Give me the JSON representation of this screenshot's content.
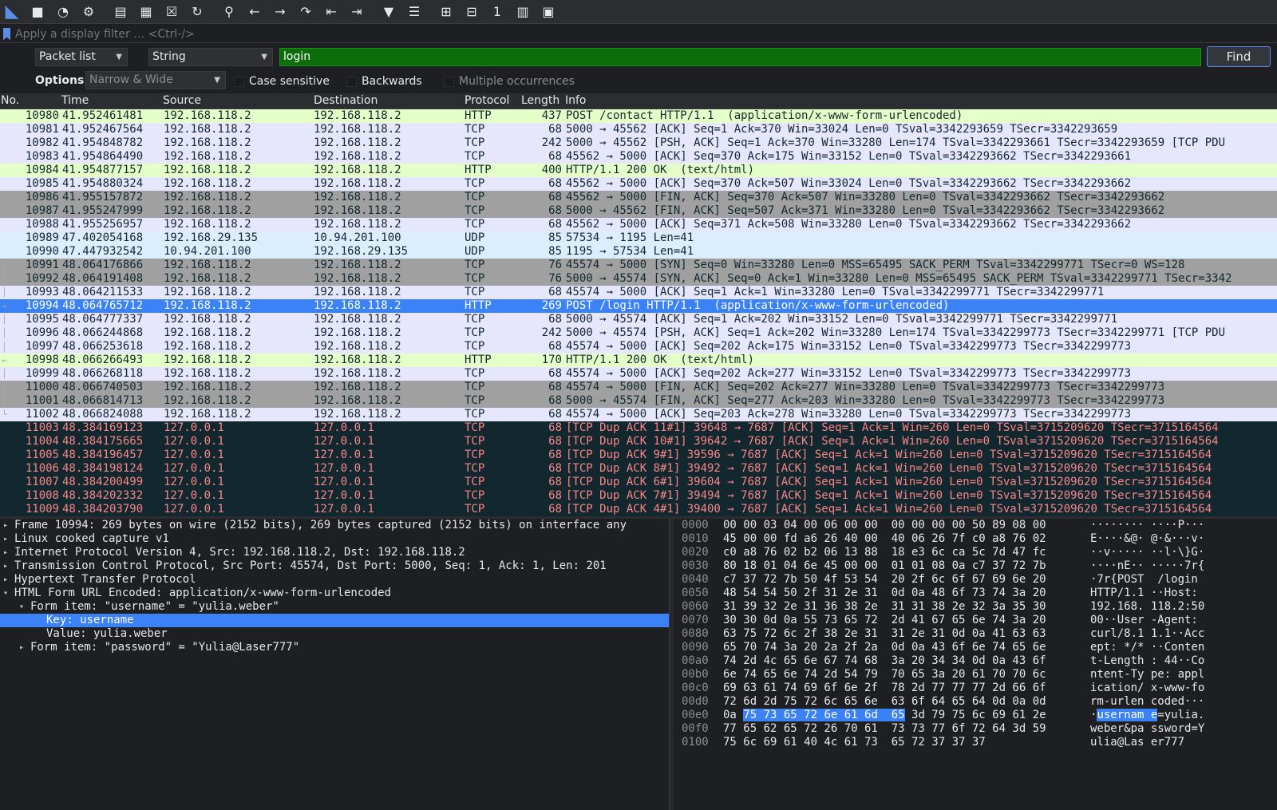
{
  "toolbar": {
    "buttons": [
      {
        "name": "shark-fin-start-icon",
        "glyph": "◣"
      },
      {
        "name": "stop-capture-icon",
        "glyph": "■"
      },
      {
        "name": "restart-capture-icon",
        "glyph": "◔"
      },
      {
        "name": "capture-options-icon",
        "glyph": "⚙"
      },
      {
        "name": "open-file-icon",
        "glyph": "▤"
      },
      {
        "name": "save-file-icon",
        "glyph": "▦"
      },
      {
        "name": "close-file-icon",
        "glyph": "☒"
      },
      {
        "name": "reload-file-icon",
        "glyph": "↻"
      },
      {
        "name": "find-packet-icon",
        "glyph": "⚲"
      },
      {
        "name": "go-back-icon",
        "glyph": "←"
      },
      {
        "name": "go-forward-icon",
        "glyph": "→"
      },
      {
        "name": "go-to-packet-icon",
        "glyph": "↷"
      },
      {
        "name": "first-packet-icon",
        "glyph": "⇤"
      },
      {
        "name": "last-packet-icon",
        "glyph": "⇥"
      },
      {
        "name": "auto-scroll-icon",
        "glyph": "▼"
      },
      {
        "name": "colorize-icon",
        "glyph": "☰"
      },
      {
        "name": "zoom-in-icon",
        "glyph": "⊞"
      },
      {
        "name": "zoom-out-icon",
        "glyph": "⊟"
      },
      {
        "name": "normal-size-icon",
        "glyph": "1"
      },
      {
        "name": "resize-columns-icon",
        "glyph": "▥"
      },
      {
        "name": "layout-icon",
        "glyph": "▣"
      }
    ]
  },
  "filter": {
    "placeholder": "Apply a display filter … <Ctrl-/>"
  },
  "find": {
    "search_in": "Packet list",
    "search_type": "String",
    "query": "login",
    "find_label": "Find"
  },
  "options": {
    "label": "Options:",
    "charset": "Narrow & Wide",
    "case_sensitive": "Case sensitive",
    "backwards": "Backwards",
    "multiple": "Multiple occurrences"
  },
  "packet_list": {
    "columns": [
      "No.",
      "Time",
      "Source",
      "Destination",
      "Protocol",
      "Length",
      "Info"
    ],
    "rows": [
      {
        "no": "10980",
        "time": "41.952461481",
        "src": "192.168.118.2",
        "dst": "192.168.118.2",
        "proto": "HTTP",
        "len": "437",
        "info": "POST /contact HTTP/1.1  (application/x-www-form-urlencoded)",
        "style": "http",
        "rel": ""
      },
      {
        "no": "10981",
        "time": "41.952467564",
        "src": "192.168.118.2",
        "dst": "192.168.118.2",
        "proto": "TCP",
        "len": "68",
        "info": "5000 → 45562 [ACK] Seq=1 Ack=370 Win=33024 Len=0 TSval=3342293659 TSecr=3342293659",
        "style": "tcp",
        "rel": ""
      },
      {
        "no": "10982",
        "time": "41.954848782",
        "src": "192.168.118.2",
        "dst": "192.168.118.2",
        "proto": "TCP",
        "len": "242",
        "info": "5000 → 45562 [PSH, ACK] Seq=1 Ack=370 Win=33280 Len=174 TSval=3342293661 TSecr=3342293659 [TCP PDU",
        "style": "tcp",
        "rel": ""
      },
      {
        "no": "10983",
        "time": "41.954864490",
        "src": "192.168.118.2",
        "dst": "192.168.118.2",
        "proto": "TCP",
        "len": "68",
        "info": "45562 → 5000 [ACK] Seq=370 Ack=175 Win=33152 Len=0 TSval=3342293662 TSecr=3342293661",
        "style": "tcp",
        "rel": ""
      },
      {
        "no": "10984",
        "time": "41.954877157",
        "src": "192.168.118.2",
        "dst": "192.168.118.2",
        "proto": "HTTP",
        "len": "400",
        "info": "HTTP/1.1 200 OK  (text/html)",
        "style": "http",
        "rel": ""
      },
      {
        "no": "10985",
        "time": "41.954880324",
        "src": "192.168.118.2",
        "dst": "192.168.118.2",
        "proto": "TCP",
        "len": "68",
        "info": "45562 → 5000 [ACK] Seq=370 Ack=507 Win=33024 Len=0 TSval=3342293662 TSecr=3342293662",
        "style": "tcp",
        "rel": ""
      },
      {
        "no": "10986",
        "time": "41.955157872",
        "src": "192.168.118.2",
        "dst": "192.168.118.2",
        "proto": "TCP",
        "len": "68",
        "info": "45562 → 5000 [FIN, ACK] Seq=370 Ack=507 Win=33280 Len=0 TSval=3342293662 TSecr=3342293662",
        "style": "fin",
        "rel": ""
      },
      {
        "no": "10987",
        "time": "41.955247999",
        "src": "192.168.118.2",
        "dst": "192.168.118.2",
        "proto": "TCP",
        "len": "68",
        "info": "5000 → 45562 [FIN, ACK] Seq=507 Ack=371 Win=33280 Len=0 TSval=3342293662 TSecr=3342293662",
        "style": "fin",
        "rel": ""
      },
      {
        "no": "10988",
        "time": "41.955256957",
        "src": "192.168.118.2",
        "dst": "192.168.118.2",
        "proto": "TCP",
        "len": "68",
        "info": "45562 → 5000 [ACK] Seq=371 Ack=508 Win=33280 Len=0 TSval=3342293662 TSecr=3342293662",
        "style": "tcp",
        "rel": ""
      },
      {
        "no": "10989",
        "time": "47.402054168",
        "src": "192.168.29.135",
        "dst": "10.94.201.100",
        "proto": "UDP",
        "len": "85",
        "info": "57534 → 1195 Len=41",
        "style": "udp",
        "rel": ""
      },
      {
        "no": "10990",
        "time": "47.447932542",
        "src": "10.94.201.100",
        "dst": "192.168.29.135",
        "proto": "UDP",
        "len": "85",
        "info": "1195 → 57534 Len=41",
        "style": "udp",
        "rel": ""
      },
      {
        "no": "10991",
        "time": "48.064176866",
        "src": "192.168.118.2",
        "dst": "192.168.118.2",
        "proto": "TCP",
        "len": "76",
        "info": "45574 → 5000 [SYN] Seq=0 Win=33280 Len=0 MSS=65495 SACK_PERM TSval=3342299771 TSecr=0 WS=128",
        "style": "fin",
        "rel": "┌"
      },
      {
        "no": "10992",
        "time": "48.064191408",
        "src": "192.168.118.2",
        "dst": "192.168.118.2",
        "proto": "TCP",
        "len": "76",
        "info": "5000 → 45574 [SYN, ACK] Seq=0 Ack=1 Win=33280 Len=0 MSS=65495 SACK_PERM TSval=3342299771 TSecr=3342",
        "style": "fin",
        "rel": "│"
      },
      {
        "no": "10993",
        "time": "48.064211533",
        "src": "192.168.118.2",
        "dst": "192.168.118.2",
        "proto": "TCP",
        "len": "68",
        "info": "45574 → 5000 [ACK] Seq=1 Ack=1 Win=33280 Len=0 TSval=3342299771 TSecr=3342299771",
        "style": "tcp",
        "rel": "│"
      },
      {
        "no": "10994",
        "time": "48.064765712",
        "src": "192.168.118.2",
        "dst": "192.168.118.2",
        "proto": "HTTP",
        "len": "269",
        "info": "POST /login HTTP/1.1  (application/x-www-form-urlencoded)",
        "style": "sel",
        "rel": "→"
      },
      {
        "no": "10995",
        "time": "48.064777337",
        "src": "192.168.118.2",
        "dst": "192.168.118.2",
        "proto": "TCP",
        "len": "68",
        "info": "5000 → 45574 [ACK] Seq=1 Ack=202 Win=33152 Len=0 TSval=3342299771 TSecr=3342299771",
        "style": "tcp",
        "rel": "│"
      },
      {
        "no": "10996",
        "time": "48.066244868",
        "src": "192.168.118.2",
        "dst": "192.168.118.2",
        "proto": "TCP",
        "len": "242",
        "info": "5000 → 45574 [PSH, ACK] Seq=1 Ack=202 Win=33280 Len=174 TSval=3342299773 TSecr=3342299771 [TCP PDU",
        "style": "tcp",
        "rel": "│"
      },
      {
        "no": "10997",
        "time": "48.066253618",
        "src": "192.168.118.2",
        "dst": "192.168.118.2",
        "proto": "TCP",
        "len": "68",
        "info": "45574 → 5000 [ACK] Seq=202 Ack=175 Win=33152 Len=0 TSval=3342299773 TSecr=3342299773",
        "style": "tcp",
        "rel": "│"
      },
      {
        "no": "10998",
        "time": "48.066266493",
        "src": "192.168.118.2",
        "dst": "192.168.118.2",
        "proto": "HTTP",
        "len": "170",
        "info": "HTTP/1.1 200 OK  (text/html)",
        "style": "http",
        "rel": "←"
      },
      {
        "no": "10999",
        "time": "48.066268118",
        "src": "192.168.118.2",
        "dst": "192.168.118.2",
        "proto": "TCP",
        "len": "68",
        "info": "45574 → 5000 [ACK] Seq=202 Ack=277 Win=33152 Len=0 TSval=3342299773 TSecr=3342299773",
        "style": "tcp",
        "rel": "│"
      },
      {
        "no": "11000",
        "time": "48.066740503",
        "src": "192.168.118.2",
        "dst": "192.168.118.2",
        "proto": "TCP",
        "len": "68",
        "info": "45574 → 5000 [FIN, ACK] Seq=202 Ack=277 Win=33280 Len=0 TSval=3342299773 TSecr=3342299773",
        "style": "fin",
        "rel": "│"
      },
      {
        "no": "11001",
        "time": "48.066814713",
        "src": "192.168.118.2",
        "dst": "192.168.118.2",
        "proto": "TCP",
        "len": "68",
        "info": "5000 → 45574 [FIN, ACK] Seq=277 Ack=203 Win=33280 Len=0 TSval=3342299773 TSecr=3342299773",
        "style": "fin",
        "rel": "│"
      },
      {
        "no": "11002",
        "time": "48.066824088",
        "src": "192.168.118.2",
        "dst": "192.168.118.2",
        "proto": "TCP",
        "len": "68",
        "info": "45574 → 5000 [ACK] Seq=203 Ack=278 Win=33280 Len=0 TSval=3342299773 TSecr=3342299773",
        "style": "tcp",
        "rel": "└"
      },
      {
        "no": "11003",
        "time": "48.384169123",
        "src": "127.0.0.1",
        "dst": "127.0.0.1",
        "proto": "TCP",
        "len": "68",
        "info": "[TCP Dup ACK 11#1] 39648 → 7687 [ACK] Seq=1 Ack=1 Win=260 Len=0 TSval=3715209620 TSecr=3715164564",
        "style": "bad",
        "rel": ""
      },
      {
        "no": "11004",
        "time": "48.384175665",
        "src": "127.0.0.1",
        "dst": "127.0.0.1",
        "proto": "TCP",
        "len": "68",
        "info": "[TCP Dup ACK 10#1] 39642 → 7687 [ACK] Seq=1 Ack=1 Win=260 Len=0 TSval=3715209620 TSecr=3715164564",
        "style": "bad",
        "rel": ""
      },
      {
        "no": "11005",
        "time": "48.384196457",
        "src": "127.0.0.1",
        "dst": "127.0.0.1",
        "proto": "TCP",
        "len": "68",
        "info": "[TCP Dup ACK 9#1] 39596 → 7687 [ACK] Seq=1 Ack=1 Win=260 Len=0 TSval=3715209620 TSecr=3715164564",
        "style": "bad",
        "rel": ""
      },
      {
        "no": "11006",
        "time": "48.384198124",
        "src": "127.0.0.1",
        "dst": "127.0.0.1",
        "proto": "TCP",
        "len": "68",
        "info": "[TCP Dup ACK 8#1] 39492 → 7687 [ACK] Seq=1 Ack=1 Win=260 Len=0 TSval=3715209620 TSecr=3715164564",
        "style": "bad",
        "rel": ""
      },
      {
        "no": "11007",
        "time": "48.384200499",
        "src": "127.0.0.1",
        "dst": "127.0.0.1",
        "proto": "TCP",
        "len": "68",
        "info": "[TCP Dup ACK 6#1] 39604 → 7687 [ACK] Seq=1 Ack=1 Win=260 Len=0 TSval=3715209620 TSecr=3715164564",
        "style": "bad",
        "rel": ""
      },
      {
        "no": "11008",
        "time": "48.384202332",
        "src": "127.0.0.1",
        "dst": "127.0.0.1",
        "proto": "TCP",
        "len": "68",
        "info": "[TCP Dup ACK 7#1] 39494 → 7687 [ACK] Seq=1 Ack=1 Win=260 Len=0 TSval=3715209620 TSecr=3715164564",
        "style": "bad",
        "rel": ""
      },
      {
        "no": "11009",
        "time": "48.384203790",
        "src": "127.0.0.1",
        "dst": "127.0.0.1",
        "proto": "TCP",
        "len": "68",
        "info": "[TCP Dup ACK 4#1] 39400 → 7687 [ACK] Seq=1 Ack=1 Win=260 Len=0 TSval=3715209620 TSecr=3715164564",
        "style": "bad",
        "rel": ""
      }
    ]
  },
  "details": {
    "lines": [
      {
        "text": "Frame 10994: 269 bytes on wire (2152 bits), 269 bytes captured (2152 bits) on interface any",
        "level": 0,
        "toggle": "▸",
        "sel": false
      },
      {
        "text": "Linux cooked capture v1",
        "level": 0,
        "toggle": "▸",
        "sel": false
      },
      {
        "text": "Internet Protocol Version 4, Src: 192.168.118.2, Dst: 192.168.118.2",
        "level": 0,
        "toggle": "▸",
        "sel": false
      },
      {
        "text": "Transmission Control Protocol, Src Port: 45574, Dst Port: 5000, Seq: 1, Ack: 1, Len: 201",
        "level": 0,
        "toggle": "▸",
        "sel": false
      },
      {
        "text": "Hypertext Transfer Protocol",
        "level": 0,
        "toggle": "▸",
        "sel": false
      },
      {
        "text": "HTML Form URL Encoded: application/x-www-form-urlencoded",
        "level": 0,
        "toggle": "▾",
        "sel": false
      },
      {
        "text": "Form item: \"username\" = \"yulia.weber\"",
        "level": 1,
        "toggle": "▾",
        "sel": false
      },
      {
        "text": "Key: username",
        "level": 2,
        "toggle": "",
        "sel": true
      },
      {
        "text": "Value: yulia.weber",
        "level": 2,
        "toggle": "",
        "sel": false
      },
      {
        "text": "Form item: \"password\" = \"Yulia@Laser777\"",
        "level": 1,
        "toggle": "▸",
        "sel": false
      }
    ]
  },
  "bytes": {
    "rows": [
      {
        "off": "0000",
        "hex_pre": "00 00 03 04 00 06 00 00  00 00 00 00 50 89 08 00",
        "hex_hl": "",
        "hex_post": "",
        "asc_pre": "········ ····P···",
        "asc_hl": "",
        "asc_post": ""
      },
      {
        "off": "0010",
        "hex_pre": "45 00 00 fd a6 26 40 00  40 06 26 7f c0 a8 76 02",
        "hex_hl": "",
        "hex_post": "",
        "asc_pre": "E····&@· @·&···v·",
        "asc_hl": "",
        "asc_post": ""
      },
      {
        "off": "0020",
        "hex_pre": "c0 a8 76 02 b2 06 13 88  18 e3 6c ca 5c 7d 47 fc",
        "hex_hl": "",
        "hex_post": "",
        "asc_pre": "··v····· ··l·\\}G·",
        "asc_hl": "",
        "asc_post": ""
      },
      {
        "off": "0030",
        "hex_pre": "80 18 01 04 6e 45 00 00  01 01 08 0a c7 37 72 7b",
        "hex_hl": "",
        "hex_post": "",
        "asc_pre": "····nE·· ·····7r{",
        "asc_hl": "",
        "asc_post": ""
      },
      {
        "off": "0040",
        "hex_pre": "c7 37 72 7b 50 4f 53 54  20 2f 6c 6f 67 69 6e 20",
        "hex_hl": "",
        "hex_post": "",
        "asc_pre": "·7r{POST  /login ",
        "asc_hl": "",
        "asc_post": ""
      },
      {
        "off": "0050",
        "hex_pre": "48 54 54 50 2f 31 2e 31  0d 0a 48 6f 73 74 3a 20",
        "hex_hl": "",
        "hex_post": "",
        "asc_pre": "HTTP/1.1 ··Host: ",
        "asc_hl": "",
        "asc_post": ""
      },
      {
        "off": "0060",
        "hex_pre": "31 39 32 2e 31 36 38 2e  31 31 38 2e 32 3a 35 30",
        "hex_hl": "",
        "hex_post": "",
        "asc_pre": "192.168. 118.2:50",
        "asc_hl": "",
        "asc_post": ""
      },
      {
        "off": "0070",
        "hex_pre": "30 30 0d 0a 55 73 65 72  2d 41 67 65 6e 74 3a 20",
        "hex_hl": "",
        "hex_post": "",
        "asc_pre": "00··User -Agent: ",
        "asc_hl": "",
        "asc_post": ""
      },
      {
        "off": "0080",
        "hex_pre": "63 75 72 6c 2f 38 2e 31  31 2e 31 0d 0a 41 63 63",
        "hex_hl": "",
        "hex_post": "",
        "asc_pre": "curl/8.1 1.1··Acc",
        "asc_hl": "",
        "asc_post": ""
      },
      {
        "off": "0090",
        "hex_pre": "65 70 74 3a 20 2a 2f 2a  0d 0a 43 6f 6e 74 65 6e",
        "hex_hl": "",
        "hex_post": "",
        "asc_pre": "ept: */* ··Conten",
        "asc_hl": "",
        "asc_post": ""
      },
      {
        "off": "00a0",
        "hex_pre": "74 2d 4c 65 6e 67 74 68  3a 20 34 34 0d 0a 43 6f",
        "hex_hl": "",
        "hex_post": "",
        "asc_pre": "t-Length : 44··Co",
        "asc_hl": "",
        "asc_post": ""
      },
      {
        "off": "00b0",
        "hex_pre": "6e 74 65 6e 74 2d 54 79  70 65 3a 20 61 70 70 6c",
        "hex_hl": "",
        "hex_post": "",
        "asc_pre": "ntent-Ty pe: appl",
        "asc_hl": "",
        "asc_post": ""
      },
      {
        "off": "00c0",
        "hex_pre": "69 63 61 74 69 6f 6e 2f  78 2d 77 77 77 2d 66 6f",
        "hex_hl": "",
        "hex_post": "",
        "asc_pre": "ication/ x-www-fo",
        "asc_hl": "",
        "asc_post": ""
      },
      {
        "off": "00d0",
        "hex_pre": "72 6d 2d 75 72 6c 65 6e  63 6f 64 65 64 0d 0a 0d",
        "hex_hl": "",
        "hex_post": "",
        "asc_pre": "rm-urlen coded···",
        "asc_hl": "",
        "asc_post": ""
      },
      {
        "off": "00e0",
        "hex_pre": "0a ",
        "hex_hl": "75 73 65 72 6e 61 6d  65",
        "hex_post": " 3d 79 75 6c 69 61 2e",
        "asc_pre": "·",
        "asc_hl": "usernam e",
        "asc_post": "=yulia."
      },
      {
        "off": "00f0",
        "hex_pre": "77 65 62 65 72 26 70 61  73 73 77 6f 72 64 3d 59",
        "hex_hl": "",
        "hex_post": "",
        "asc_pre": "weber&pa ssword=Y",
        "asc_hl": "",
        "asc_post": ""
      },
      {
        "off": "0100",
        "hex_pre": "75 6c 69 61 40 4c 61 73  65 72 37 37 37",
        "hex_hl": "",
        "hex_post": "",
        "asc_pre": "ulia@Las er777",
        "asc_hl": "",
        "asc_post": ""
      }
    ]
  }
}
